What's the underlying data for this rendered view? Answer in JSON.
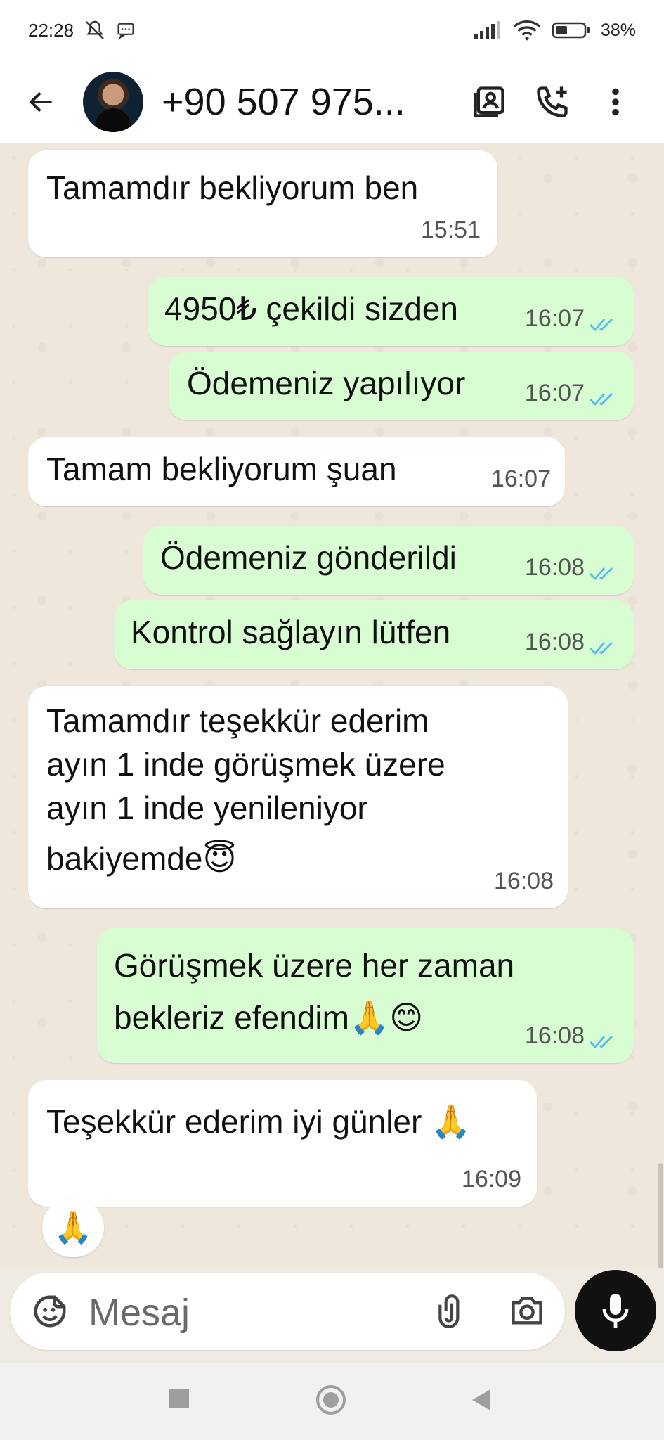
{
  "status": {
    "time": "22:28",
    "battery": "38%",
    "icons": [
      "mute-icon",
      "message-icon",
      "signal-icon",
      "wifi-icon",
      "battery-icon"
    ]
  },
  "header": {
    "title": "+90 507 975...",
    "icons": [
      "back-arrow-icon",
      "contact-card-icon",
      "add-call-icon",
      "more-icon"
    ]
  },
  "messages": [
    {
      "dir": "in",
      "text": "Tamamdır bekliyorum ben",
      "time": "15:51"
    },
    {
      "dir": "out",
      "text": "4950₺ çekildi sizden",
      "time": "16:07"
    },
    {
      "dir": "out",
      "text": "Ödemeniz yapılıyor",
      "time": "16:07"
    },
    {
      "dir": "in",
      "text": "Tamam bekliyorum şuan",
      "time": "16:07"
    },
    {
      "dir": "out",
      "text": "Ödemeniz gönderildi",
      "time": "16:08"
    },
    {
      "dir": "out",
      "text": "Kontrol sağlayın lütfen",
      "time": "16:08"
    },
    {
      "dir": "in",
      "lines": [
        "Tamamdır teşekkür ederim",
        "ayın 1 inde görüşmek üzere",
        "ayın 1 inde yenileniyor",
        "bakiyemde😇"
      ],
      "time": "16:08"
    },
    {
      "dir": "out",
      "lines": [
        "Görüşmek üzere her zaman",
        "bekleriz efendim🙏😊"
      ],
      "time": "16:08"
    },
    {
      "dir": "in",
      "text": "Teşekkür ederim iyi günler 🙏",
      "time": "16:09"
    }
  ],
  "reaction": "🙏",
  "input": {
    "placeholder": "Mesaj",
    "icons": [
      "sticker-icon",
      "attach-icon",
      "camera-icon",
      "mic-icon"
    ]
  },
  "nav": {
    "icons": [
      "recents-icon",
      "home-icon",
      "back-icon"
    ]
  },
  "colors": {
    "incoming": "#ffffff",
    "outgoing": "#d9fdd3",
    "read_ticks": "#53bdeb",
    "chat_bg": "#efe7dc"
  }
}
